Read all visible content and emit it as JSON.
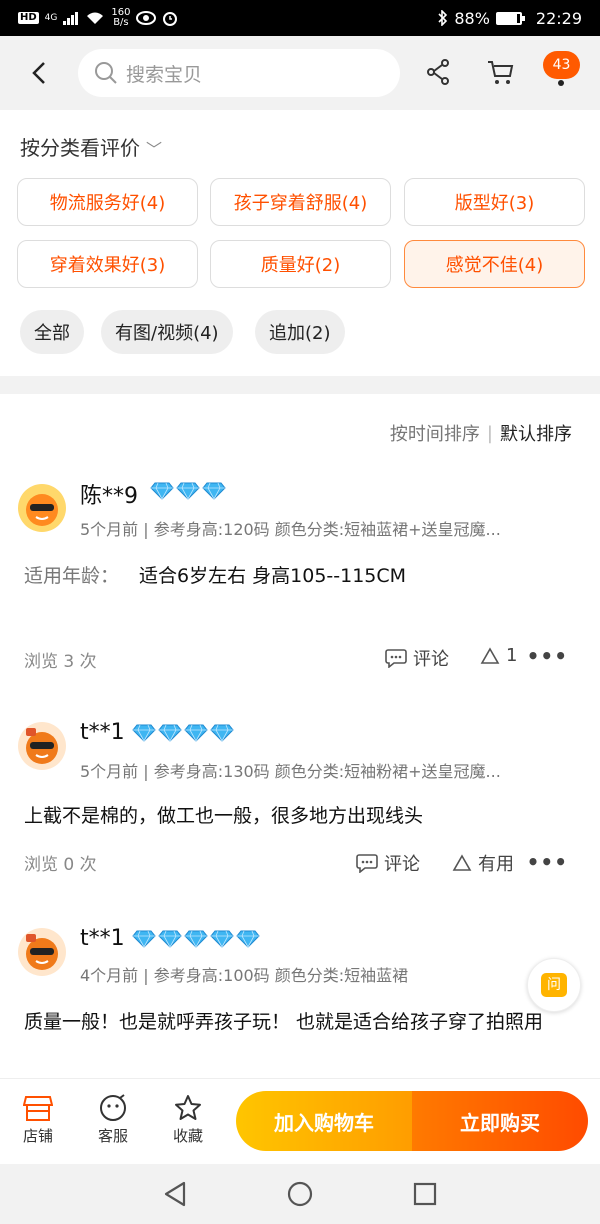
{
  "status_bar": {
    "hd": "HD",
    "signal_type": "4G",
    "speed_value": "160",
    "speed_unit": "B/s",
    "battery": "88%",
    "battery_level": 0.88,
    "time": "22:29"
  },
  "header": {
    "search_placeholder": "搜索宝贝",
    "cart_count": "43"
  },
  "categories": {
    "title": "按分类看评价",
    "tags": [
      {
        "label": "物流服务好(4)"
      },
      {
        "label": "孩子穿着舒服(4)"
      },
      {
        "label": "版型好(3)"
      },
      {
        "label": "穿着效果好(3)"
      },
      {
        "label": "质量好(2)"
      },
      {
        "label": "感觉不佳(4)"
      }
    ],
    "filters": [
      {
        "label": "全部"
      },
      {
        "label": "有图/视频(4)"
      },
      {
        "label": "追加(2)"
      }
    ]
  },
  "sort": {
    "by_time": "按时间排序",
    "default": "默认排序"
  },
  "reviews": [
    {
      "user": "陈**9",
      "gems": 3,
      "meta": "5个月前 | 参考身高:120码 颜色分类:短袖蓝裙+送皇冠魔...",
      "fit_label": "适用年龄：",
      "fit_value": "适合6岁左右  身高105--115CM",
      "views": "浏览 3 次",
      "comment": "评论",
      "like": "1"
    },
    {
      "user": "t**1",
      "gems": 4,
      "meta": "5个月前 | 参考身高:130码 颜色分类:短袖粉裙+送皇冠魔...",
      "text": "上截不是棉的，做工也一般，很多地方出现线头",
      "views": "浏览 0 次",
      "comment": "评论",
      "like": "有用"
    },
    {
      "user": "t**1",
      "gems": 5,
      "meta": "4个月前 | 参考身高:100码 颜色分类:短袖蓝裙",
      "text": "质量一般！也是就呼弄孩子玩！ 也就是适合给孩子穿了拍照用"
    }
  ],
  "ask_button": "问",
  "bottom": {
    "shop": "店铺",
    "service": "客服",
    "favorite": "收藏",
    "add_cart": "加入购物车",
    "buy_now": "立即购买"
  },
  "colors": {
    "accent": "#ff5000",
    "gem": "#3fb6f2"
  }
}
